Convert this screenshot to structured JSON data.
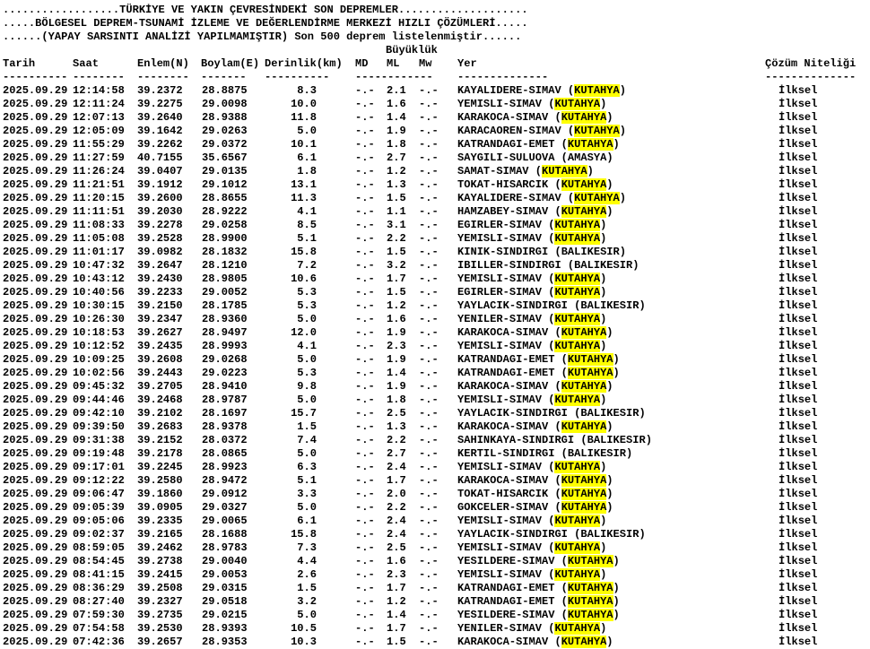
{
  "header": {
    "line1": "..................TÜRKİYE VE YAKIN ÇEVRESİNDEKİ SON DEPREMLER....................",
    "line2": ".....BÖLGESEL DEPREM-TSUNAMİ İZLEME VE DEĞERLENDİRME MERKEZİ HIZLI ÇÖZÜMLERİ.....",
    "line3": "......(YAPAY SARSINTI ANALİZİ YAPILMAMIŞTIR) Son 500 deprem listelenmiştir......"
  },
  "magnitude_group_label": "Büyüklük",
  "columns": {
    "date": "Tarih",
    "time": "Saat",
    "lat": "Enlem(N)",
    "lon": "Boylam(E)",
    "depth": "Derinlik(km)",
    "md": "MD",
    "ml": "ML",
    "mw": "Mw",
    "location": "Yer",
    "solution": "Çözüm Niteliği"
  },
  "separators": {
    "date": "----------",
    "time": "--------",
    "lat": "--------",
    "lon": "-------",
    "depth": "----------",
    "mag": "------------",
    "location": "--------------",
    "solution": "--------------"
  },
  "rows": [
    {
      "date": "2025.09.29",
      "time": "12:14:58",
      "lat": "39.2372",
      "lon": "28.8875",
      "depth": "8.3",
      "md": "-.-",
      "ml": "2.1",
      "mw": "-.-",
      "loc_prefix": "KAYALIDERE-SIMAV",
      "loc_region": "KUTAHYA",
      "highlight": true,
      "solution": "İlksel"
    },
    {
      "date": "2025.09.29",
      "time": "12:11:24",
      "lat": "39.2275",
      "lon": "29.0098",
      "depth": "10.0",
      "md": "-.-",
      "ml": "1.6",
      "mw": "-.-",
      "loc_prefix": "YEMISLI-SIMAV",
      "loc_region": "KUTAHYA",
      "highlight": true,
      "solution": "İlksel"
    },
    {
      "date": "2025.09.29",
      "time": "12:07:13",
      "lat": "39.2640",
      "lon": "28.9388",
      "depth": "11.8",
      "md": "-.-",
      "ml": "1.4",
      "mw": "-.-",
      "loc_prefix": "KARAKOCA-SIMAV",
      "loc_region": "KUTAHYA",
      "highlight": true,
      "solution": "İlksel"
    },
    {
      "date": "2025.09.29",
      "time": "12:05:09",
      "lat": "39.1642",
      "lon": "29.0263",
      "depth": "5.0",
      "md": "-.-",
      "ml": "1.9",
      "mw": "-.-",
      "loc_prefix": "KARACAOREN-SIMAV",
      "loc_region": "KUTAHYA",
      "highlight": true,
      "solution": "İlksel"
    },
    {
      "date": "2025.09.29",
      "time": "11:55:29",
      "lat": "39.2262",
      "lon": "29.0372",
      "depth": "10.1",
      "md": "-.-",
      "ml": "1.8",
      "mw": "-.-",
      "loc_prefix": "KATRANDAGI-EMET",
      "loc_region": "KUTAHYA",
      "highlight": true,
      "solution": "İlksel"
    },
    {
      "date": "2025.09.29",
      "time": "11:27:59",
      "lat": "40.7155",
      "lon": "35.6567",
      "depth": "6.1",
      "md": "-.-",
      "ml": "2.7",
      "mw": "-.-",
      "loc_prefix": "SAYGILI-SULUOVA",
      "loc_region": "AMASYA",
      "highlight": false,
      "solution": "İlksel"
    },
    {
      "date": "2025.09.29",
      "time": "11:26:24",
      "lat": "39.0407",
      "lon": "29.0135",
      "depth": "1.8",
      "md": "-.-",
      "ml": "1.2",
      "mw": "-.-",
      "loc_prefix": "SAMAT-SIMAV",
      "loc_region": "KUTAHYA",
      "highlight": true,
      "solution": "İlksel"
    },
    {
      "date": "2025.09.29",
      "time": "11:21:51",
      "lat": "39.1912",
      "lon": "29.1012",
      "depth": "13.1",
      "md": "-.-",
      "ml": "1.3",
      "mw": "-.-",
      "loc_prefix": "TOKAT-HISARCIK",
      "loc_region": "KUTAHYA",
      "highlight": true,
      "solution": "İlksel"
    },
    {
      "date": "2025.09.29",
      "time": "11:20:15",
      "lat": "39.2600",
      "lon": "28.8655",
      "depth": "11.3",
      "md": "-.-",
      "ml": "1.5",
      "mw": "-.-",
      "loc_prefix": "KAYALIDERE-SIMAV",
      "loc_region": "KUTAHYA",
      "highlight": true,
      "solution": "İlksel"
    },
    {
      "date": "2025.09.29",
      "time": "11:11:51",
      "lat": "39.2030",
      "lon": "28.9222",
      "depth": "4.1",
      "md": "-.-",
      "ml": "1.1",
      "mw": "-.-",
      "loc_prefix": "HAMZABEY-SIMAV",
      "loc_region": "KUTAHYA",
      "highlight": true,
      "solution": "İlksel"
    },
    {
      "date": "2025.09.29",
      "time": "11:08:33",
      "lat": "39.2278",
      "lon": "29.0258",
      "depth": "8.5",
      "md": "-.-",
      "ml": "3.1",
      "mw": "-.-",
      "loc_prefix": "EGIRLER-SIMAV",
      "loc_region": "KUTAHYA",
      "highlight": true,
      "solution": "İlksel"
    },
    {
      "date": "2025.09.29",
      "time": "11:05:08",
      "lat": "39.2528",
      "lon": "28.9900",
      "depth": "5.1",
      "md": "-.-",
      "ml": "2.2",
      "mw": "-.-",
      "loc_prefix": "YEMISLI-SIMAV",
      "loc_region": "KUTAHYA",
      "highlight": true,
      "solution": "İlksel"
    },
    {
      "date": "2025.09.29",
      "time": "11:01:17",
      "lat": "39.0982",
      "lon": "28.1832",
      "depth": "15.8",
      "md": "-.-",
      "ml": "1.5",
      "mw": "-.-",
      "loc_prefix": "KINIK-SINDIRGI",
      "loc_region": "BALIKESIR",
      "highlight": false,
      "solution": "İlksel"
    },
    {
      "date": "2025.09.29",
      "time": "10:47:32",
      "lat": "39.2647",
      "lon": "28.1210",
      "depth": "7.2",
      "md": "-.-",
      "ml": "3.2",
      "mw": "-.-",
      "loc_prefix": "IBILLER-SINDIRGI",
      "loc_region": "BALIKESIR",
      "highlight": false,
      "solution": "İlksel"
    },
    {
      "date": "2025.09.29",
      "time": "10:43:12",
      "lat": "39.2430",
      "lon": "28.9805",
      "depth": "10.6",
      "md": "-.-",
      "ml": "1.7",
      "mw": "-.-",
      "loc_prefix": "YEMISLI-SIMAV",
      "loc_region": "KUTAHYA",
      "highlight": true,
      "solution": "İlksel"
    },
    {
      "date": "2025.09.29",
      "time": "10:40:56",
      "lat": "39.2233",
      "lon": "29.0052",
      "depth": "5.3",
      "md": "-.-",
      "ml": "1.5",
      "mw": "-.-",
      "loc_prefix": "EGIRLER-SIMAV",
      "loc_region": "KUTAHYA",
      "highlight": true,
      "solution": "İlksel"
    },
    {
      "date": "2025.09.29",
      "time": "10:30:15",
      "lat": "39.2150",
      "lon": "28.1785",
      "depth": "5.3",
      "md": "-.-",
      "ml": "1.2",
      "mw": "-.-",
      "loc_prefix": "YAYLACIK-SINDIRGI",
      "loc_region": "BALIKESIR",
      "highlight": false,
      "solution": "İlksel"
    },
    {
      "date": "2025.09.29",
      "time": "10:26:30",
      "lat": "39.2347",
      "lon": "28.9360",
      "depth": "5.0",
      "md": "-.-",
      "ml": "1.6",
      "mw": "-.-",
      "loc_prefix": "YENILER-SIMAV",
      "loc_region": "KUTAHYA",
      "highlight": true,
      "solution": "İlksel"
    },
    {
      "date": "2025.09.29",
      "time": "10:18:53",
      "lat": "39.2627",
      "lon": "28.9497",
      "depth": "12.0",
      "md": "-.-",
      "ml": "1.9",
      "mw": "-.-",
      "loc_prefix": "KARAKOCA-SIMAV",
      "loc_region": "KUTAHYA",
      "highlight": true,
      "solution": "İlksel"
    },
    {
      "date": "2025.09.29",
      "time": "10:12:52",
      "lat": "39.2435",
      "lon": "28.9993",
      "depth": "4.1",
      "md": "-.-",
      "ml": "2.3",
      "mw": "-.-",
      "loc_prefix": "YEMISLI-SIMAV",
      "loc_region": "KUTAHYA",
      "highlight": true,
      "solution": "İlksel"
    },
    {
      "date": "2025.09.29",
      "time": "10:09:25",
      "lat": "39.2608",
      "lon": "29.0268",
      "depth": "5.0",
      "md": "-.-",
      "ml": "1.9",
      "mw": "-.-",
      "loc_prefix": "KATRANDAGI-EMET",
      "loc_region": "KUTAHYA",
      "highlight": true,
      "solution": "İlksel"
    },
    {
      "date": "2025.09.29",
      "time": "10:02:56",
      "lat": "39.2443",
      "lon": "29.0223",
      "depth": "5.3",
      "md": "-.-",
      "ml": "1.4",
      "mw": "-.-",
      "loc_prefix": "KATRANDAGI-EMET",
      "loc_region": "KUTAHYA",
      "highlight": true,
      "solution": "İlksel"
    },
    {
      "date": "2025.09.29",
      "time": "09:45:32",
      "lat": "39.2705",
      "lon": "28.9410",
      "depth": "9.8",
      "md": "-.-",
      "ml": "1.9",
      "mw": "-.-",
      "loc_prefix": "KARAKOCA-SIMAV",
      "loc_region": "KUTAHYA",
      "highlight": true,
      "solution": "İlksel"
    },
    {
      "date": "2025.09.29",
      "time": "09:44:46",
      "lat": "39.2468",
      "lon": "28.9787",
      "depth": "5.0",
      "md": "-.-",
      "ml": "1.8",
      "mw": "-.-",
      "loc_prefix": "YEMISLI-SIMAV",
      "loc_region": "KUTAHYA",
      "highlight": true,
      "solution": "İlksel"
    },
    {
      "date": "2025.09.29",
      "time": "09:42:10",
      "lat": "39.2102",
      "lon": "28.1697",
      "depth": "15.7",
      "md": "-.-",
      "ml": "2.5",
      "mw": "-.-",
      "loc_prefix": "YAYLACIK-SINDIRGI",
      "loc_region": "BALIKESIR",
      "highlight": false,
      "solution": "İlksel"
    },
    {
      "date": "2025.09.29",
      "time": "09:39:50",
      "lat": "39.2683",
      "lon": "28.9378",
      "depth": "1.5",
      "md": "-.-",
      "ml": "1.3",
      "mw": "-.-",
      "loc_prefix": "KARAKOCA-SIMAV",
      "loc_region": "KUTAHYA",
      "highlight": true,
      "solution": "İlksel"
    },
    {
      "date": "2025.09.29",
      "time": "09:31:38",
      "lat": "39.2152",
      "lon": "28.0372",
      "depth": "7.4",
      "md": "-.-",
      "ml": "2.2",
      "mw": "-.-",
      "loc_prefix": "SAHINKAYA-SINDIRGI",
      "loc_region": "BALIKESIR",
      "highlight": false,
      "solution": "İlksel"
    },
    {
      "date": "2025.09.29",
      "time": "09:19:48",
      "lat": "39.2178",
      "lon": "28.0865",
      "depth": "5.0",
      "md": "-.-",
      "ml": "2.7",
      "mw": "-.-",
      "loc_prefix": "KERTIL-SINDIRGI",
      "loc_region": "BALIKESIR",
      "highlight": false,
      "solution": "İlksel"
    },
    {
      "date": "2025.09.29",
      "time": "09:17:01",
      "lat": "39.2245",
      "lon": "28.9923",
      "depth": "6.3",
      "md": "-.-",
      "ml": "2.4",
      "mw": "-.-",
      "loc_prefix": "YEMISLI-SIMAV",
      "loc_region": "KUTAHYA",
      "highlight": true,
      "solution": "İlksel"
    },
    {
      "date": "2025.09.29",
      "time": "09:12:22",
      "lat": "39.2580",
      "lon": "28.9472",
      "depth": "5.1",
      "md": "-.-",
      "ml": "1.7",
      "mw": "-.-",
      "loc_prefix": "KARAKOCA-SIMAV",
      "loc_region": "KUTAHYA",
      "highlight": true,
      "solution": "İlksel"
    },
    {
      "date": "2025.09.29",
      "time": "09:06:47",
      "lat": "39.1860",
      "lon": "29.0912",
      "depth": "3.3",
      "md": "-.-",
      "ml": "2.0",
      "mw": "-.-",
      "loc_prefix": "TOKAT-HISARCIK",
      "loc_region": "KUTAHYA",
      "highlight": true,
      "solution": "İlksel"
    },
    {
      "date": "2025.09.29",
      "time": "09:05:39",
      "lat": "39.0905",
      "lon": "29.0327",
      "depth": "5.0",
      "md": "-.-",
      "ml": "2.2",
      "mw": "-.-",
      "loc_prefix": "GOKCELER-SIMAV",
      "loc_region": "KUTAHYA",
      "highlight": true,
      "solution": "İlksel"
    },
    {
      "date": "2025.09.29",
      "time": "09:05:06",
      "lat": "39.2335",
      "lon": "29.0065",
      "depth": "6.1",
      "md": "-.-",
      "ml": "2.4",
      "mw": "-.-",
      "loc_prefix": "YEMISLI-SIMAV",
      "loc_region": "KUTAHYA",
      "highlight": true,
      "solution": "İlksel"
    },
    {
      "date": "2025.09.29",
      "time": "09:02:37",
      "lat": "39.2165",
      "lon": "28.1688",
      "depth": "15.8",
      "md": "-.-",
      "ml": "2.4",
      "mw": "-.-",
      "loc_prefix": "YAYLACIK-SINDIRGI",
      "loc_region": "BALIKESIR",
      "highlight": false,
      "solution": "İlksel"
    },
    {
      "date": "2025.09.29",
      "time": "08:59:05",
      "lat": "39.2462",
      "lon": "28.9783",
      "depth": "7.3",
      "md": "-.-",
      "ml": "2.5",
      "mw": "-.-",
      "loc_prefix": "YEMISLI-SIMAV",
      "loc_region": "KUTAHYA",
      "highlight": true,
      "solution": "İlksel"
    },
    {
      "date": "2025.09.29",
      "time": "08:54:45",
      "lat": "39.2738",
      "lon": "29.0040",
      "depth": "4.4",
      "md": "-.-",
      "ml": "1.6",
      "mw": "-.-",
      "loc_prefix": "YESILDERE-SIMAV",
      "loc_region": "KUTAHYA",
      "highlight": true,
      "solution": "İlksel"
    },
    {
      "date": "2025.09.29",
      "time": "08:41:15",
      "lat": "39.2415",
      "lon": "29.0053",
      "depth": "2.6",
      "md": "-.-",
      "ml": "2.3",
      "mw": "-.-",
      "loc_prefix": "YEMISLI-SIMAV",
      "loc_region": "KUTAHYA",
      "highlight": true,
      "solution": "İlksel"
    },
    {
      "date": "2025.09.29",
      "time": "08:36:29",
      "lat": "39.2508",
      "lon": "29.0315",
      "depth": "1.5",
      "md": "-.-",
      "ml": "1.7",
      "mw": "-.-",
      "loc_prefix": "KATRANDAGI-EMET",
      "loc_region": "KUTAHYA",
      "highlight": true,
      "solution": "İlksel"
    },
    {
      "date": "2025.09.29",
      "time": "08:27:40",
      "lat": "39.2327",
      "lon": "29.0518",
      "depth": "3.2",
      "md": "-.-",
      "ml": "1.2",
      "mw": "-.-",
      "loc_prefix": "KATRANDAGI-EMET",
      "loc_region": "KUTAHYA",
      "highlight": true,
      "solution": "İlksel"
    },
    {
      "date": "2025.09.29",
      "time": "07:59:30",
      "lat": "39.2735",
      "lon": "29.0215",
      "depth": "5.0",
      "md": "-.-",
      "ml": "1.4",
      "mw": "-.-",
      "loc_prefix": "YESILDERE-SIMAV",
      "loc_region": "KUTAHYA",
      "highlight": true,
      "solution": "İlksel"
    },
    {
      "date": "2025.09.29",
      "time": "07:54:58",
      "lat": "39.2530",
      "lon": "28.9393",
      "depth": "10.5",
      "md": "-.-",
      "ml": "1.7",
      "mw": "-.-",
      "loc_prefix": "YENILER-SIMAV",
      "loc_region": "KUTAHYA",
      "highlight": true,
      "solution": "İlksel"
    },
    {
      "date": "2025.09.29",
      "time": "07:42:36",
      "lat": "39.2657",
      "lon": "28.9353",
      "depth": "10.3",
      "md": "-.-",
      "ml": "1.5",
      "mw": "-.-",
      "loc_prefix": "KARAKOCA-SIMAV",
      "loc_region": "KUTAHYA",
      "highlight": true,
      "solution": "İlksel"
    }
  ],
  "colors": {
    "background": "#ffffff",
    "text": "#000000",
    "highlight": "#ffff00"
  }
}
